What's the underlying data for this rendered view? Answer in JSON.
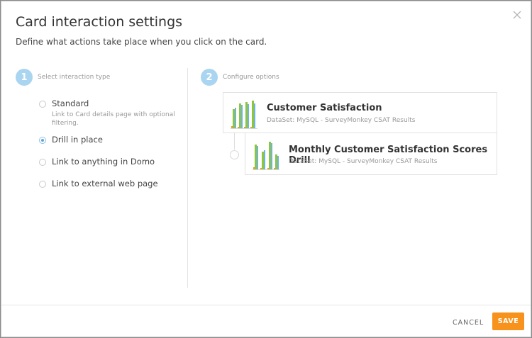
{
  "dialog": {
    "title": "Card interaction settings",
    "subtitle": "Define what actions take place when you click on the card."
  },
  "step1": {
    "number": "1",
    "label": "Select interaction type"
  },
  "step2": {
    "number": "2",
    "label": "Configure options"
  },
  "options": [
    {
      "label": "Standard",
      "description": "Link to Card details page with optional filtering.",
      "selected": false
    },
    {
      "label": "Drill in place",
      "selected": true
    },
    {
      "label": "Link to anything in Domo",
      "selected": false
    },
    {
      "label": "Link to external web page",
      "selected": false
    }
  ],
  "cards": [
    {
      "name": "Customer Satisfaction",
      "dataset": "DataSet: MySQL - SurveyMonkey CSAT Results"
    },
    {
      "name": "Monthly Customer Satisfaction Scores Drill",
      "dataset": "DataSet: MySQL - SurveyMonkey CSAT Results"
    }
  ],
  "footer": {
    "cancel_label": "CANCEL",
    "save_label": "SAVE"
  },
  "colors": {
    "accent": "#f7931d",
    "step": "#a9d5f1",
    "bar_green": "#8cc63f",
    "bar_blue": "#6db3e6",
    "bar_orange": "#f29a2e"
  },
  "icons": {
    "close": "close-icon",
    "thumbnail": "bar-chart-thumbnail-icon"
  }
}
